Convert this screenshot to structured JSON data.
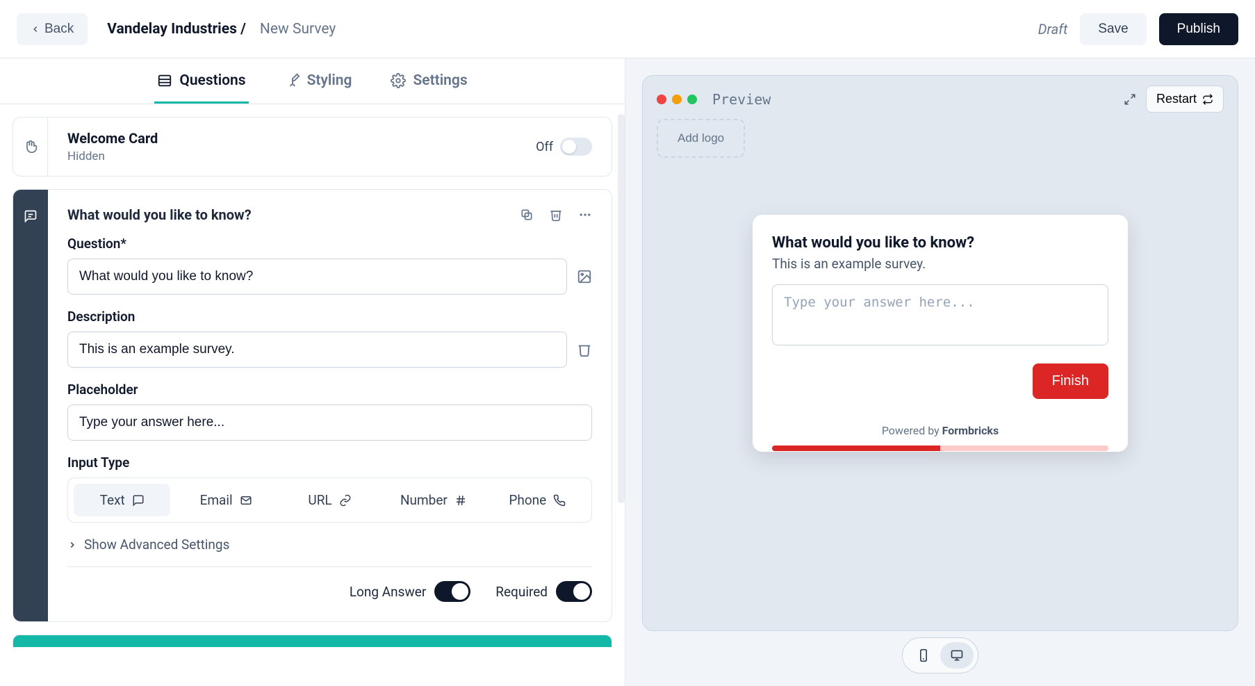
{
  "header": {
    "back": "Back",
    "org": "Vandelay Industries /",
    "page": "New Survey",
    "status": "Draft",
    "save": "Save",
    "publish": "Publish"
  },
  "tabs": {
    "questions": "Questions",
    "styling": "Styling",
    "settings": "Settings"
  },
  "welcome": {
    "title": "Welcome Card",
    "subtitle": "Hidden",
    "state": "Off"
  },
  "question": {
    "title": "What would you like to know?",
    "labels": {
      "question": "Question*",
      "description": "Description",
      "placeholder": "Placeholder",
      "inputType": "Input Type",
      "advanced": "Show Advanced Settings",
      "longAnswer": "Long Answer",
      "required": "Required"
    },
    "values": {
      "question": "What would you like to know?",
      "description": "This is an example survey.",
      "placeholder": "Type your answer here..."
    },
    "inputTypes": {
      "text": "Text",
      "email": "Email",
      "url": "URL",
      "number": "Number",
      "phone": "Phone"
    }
  },
  "preview": {
    "label": "Preview",
    "restart": "Restart",
    "addLogo": "Add logo",
    "surveyTitle": "What would you like to know?",
    "surveyDesc": "This is an example survey.",
    "surveyPlaceholder": "Type your answer here...",
    "finish": "Finish",
    "poweredPrefix": "Powered by ",
    "poweredBrand": "Formbricks"
  }
}
